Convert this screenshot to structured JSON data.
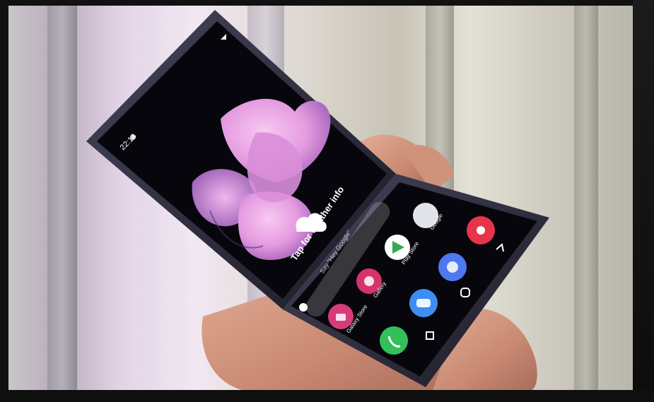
{
  "photo": {
    "subject": "foldable-phone-in-hand",
    "colors": {
      "phone_frame": "#2a2838",
      "screen": "#07060c",
      "flower_pink": "#e5a2e0",
      "flower_violet": "#b77fcf",
      "background_light": "#efe7f0",
      "skin": "#d59c86"
    }
  },
  "screen": {
    "status_time": "22:14",
    "weather_widget": "Tap for weather info",
    "search_hint": "Say \"Hey Google\"",
    "apps": [
      {
        "label": "Google",
        "icon": "google-folder-icon",
        "color": "#e2e4ea"
      },
      {
        "label": "Play Store",
        "icon": "play-store-icon",
        "color": "#ffffff"
      },
      {
        "label": "Gallery",
        "icon": "gallery-icon",
        "color": "#d6336b"
      },
      {
        "label": "Galaxy Store",
        "icon": "galaxy-store-icon",
        "color": "#d63b7a"
      }
    ],
    "dock": [
      {
        "icon": "phone-icon",
        "color": "#33c05a"
      },
      {
        "icon": "messages-icon",
        "color": "#3d8ef2"
      },
      {
        "icon": "internet-icon",
        "color": "#4d78f0"
      },
      {
        "icon": "camera-icon",
        "color": "#e6344a"
      }
    ]
  }
}
